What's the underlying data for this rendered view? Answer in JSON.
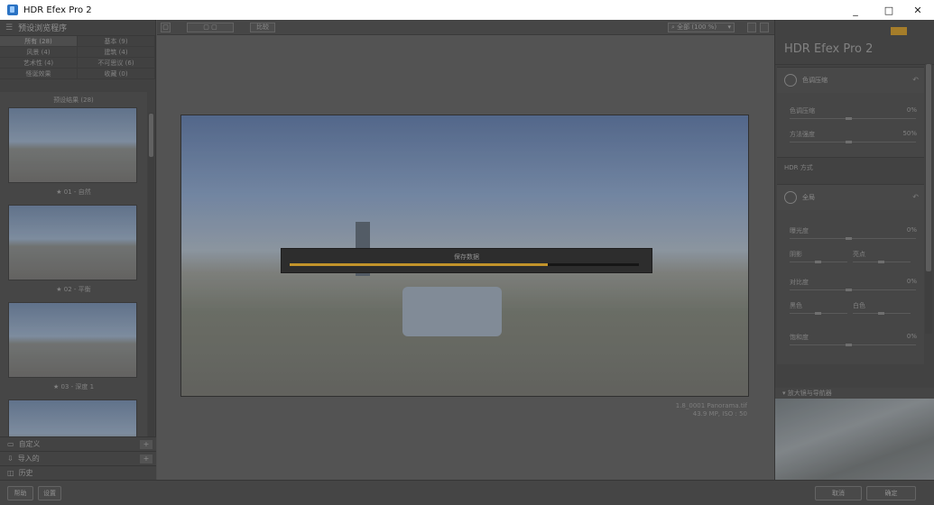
{
  "window": {
    "title": "HDR Efex Pro 2",
    "controls": [
      "_",
      "□",
      "✕"
    ]
  },
  "left_panel": {
    "header": "预设浏览程序",
    "categories": [
      {
        "label": "所有 (28)"
      },
      {
        "label": "基本 (9)"
      },
      {
        "label": "风景 (4)"
      },
      {
        "label": "建筑 (4)"
      },
      {
        "label": "艺术性 (4)"
      },
      {
        "label": "不可思议 (6)"
      },
      {
        "label": "怪诞效果"
      },
      {
        "label": "收藏 (0)"
      }
    ],
    "strip_caption": "预设结果 (28)",
    "thumbnails": [
      {
        "label": "★ 01 - 自然"
      },
      {
        "label": "★ 02 - 平衡"
      },
      {
        "label": "★ 03 - 深度 1"
      },
      {
        "label": ""
      }
    ],
    "footer_rows": [
      {
        "label": "自定义",
        "plus": "+"
      },
      {
        "label": "导入的",
        "plus": "+"
      },
      {
        "label": "历史"
      }
    ]
  },
  "bottom_bar": {
    "help_button": "帮助",
    "settings_button": "设置",
    "cancel_button": "取消",
    "ok_button": "确定"
  },
  "toolbar": {
    "view_buttons": [
      "▢",
      "▢ ▢",
      "▢|▢"
    ],
    "compare_button": "比较",
    "zoom_select": "全部 (100 %)"
  },
  "preview": {
    "progress_title": "保存数据",
    "progress_fraction": 0.74,
    "filename": "1.8_0001 Panorama.tif",
    "meta": "43.9 MP, ISO : 50"
  },
  "right_panel": {
    "brand": "HDR Efex Pro 2",
    "section1": {
      "title": "色调压缩",
      "params": [
        {
          "label": "色调压缩",
          "value": "0%"
        },
        {
          "label": "方法强度",
          "value": "50%"
        }
      ]
    },
    "hdr_method": "HDR 方式",
    "section2": {
      "title": "全局",
      "params": [
        {
          "label": "曝光度",
          "value": "0%"
        },
        {
          "label": "对比度",
          "value": "0%"
        },
        {
          "label": "饱和度",
          "value": "0%"
        }
      ],
      "pairs": [
        {
          "left": "阴影",
          "right": "亮点"
        },
        {
          "left": "黑色",
          "right": "白色"
        }
      ]
    },
    "navigator": "放大镜与导航器"
  },
  "colors": {
    "accent_progress": "#d9a32c",
    "panel_bg": "#474747",
    "canvas_bg": "#5a5a5a"
  }
}
